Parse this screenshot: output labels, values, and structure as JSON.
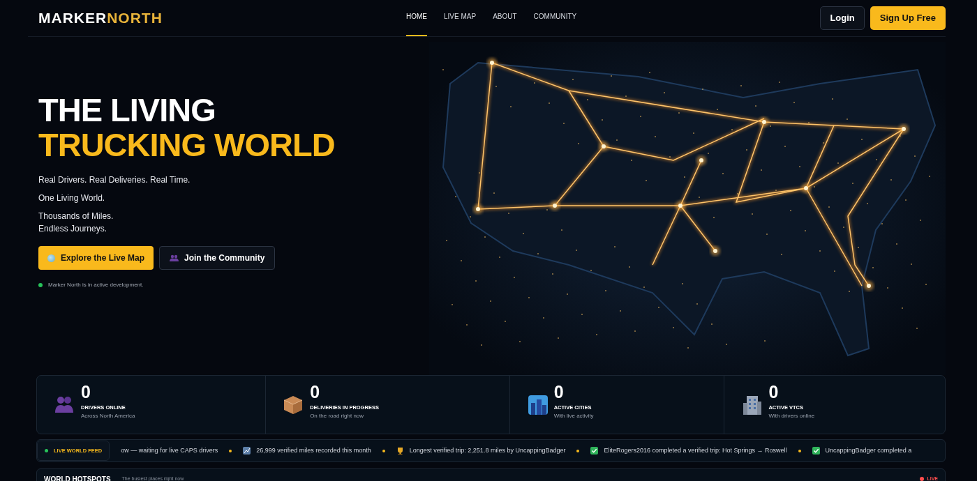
{
  "brand": {
    "first": "MARKER",
    "second": "NORTH"
  },
  "nav": [
    {
      "label": "HOME",
      "selected": true
    },
    {
      "label": "LIVE MAP",
      "selected": false
    },
    {
      "label": "ABOUT",
      "selected": false
    },
    {
      "label": "COMMUNITY",
      "selected": false
    }
  ],
  "auth": {
    "login": "Login",
    "signup": "Sign Up Free"
  },
  "hero": {
    "title": "THE LIVING",
    "title_highlight": "TRUCKING WORLD",
    "lines": [
      [
        "Real Drivers. Real Deliveries. Real Time."
      ],
      [
        "One Living World."
      ],
      [
        "Thousands of Miles.",
        "Endless Journeys."
      ]
    ],
    "buttons": [
      {
        "kind": "primary",
        "label": "Explore the Live Map"
      },
      {
        "kind": "outline",
        "label": "Join the Community"
      }
    ],
    "status": "Marker North is in active development."
  },
  "stats": [
    {
      "kind": "drivers",
      "value": "0",
      "label": "DRIVERS ONLINE",
      "sub": "Across North America"
    },
    {
      "kind": "deliveries",
      "value": "0",
      "label": "DELIVERIES IN PROGRESS",
      "sub": "On the road right now"
    },
    {
      "kind": "cities",
      "value": "0",
      "label": "ACTIVE CITIES",
      "sub": "With live activity"
    },
    {
      "kind": "vtcs",
      "value": "0",
      "label": "ACTIVE VTCS",
      "sub": "With drivers online"
    }
  ],
  "feed": {
    "label": "LIVE WORLD FEED",
    "items": [
      {
        "kind": "text",
        "text": "ow — waiting for live CAPS drivers"
      },
      {
        "kind": "chart",
        "text": "26,999 verified miles recorded this month"
      },
      {
        "kind": "trophy",
        "text": "Longest verified trip: 2,251.8 miles by UncappingBadger"
      },
      {
        "kind": "check",
        "text": "EliteRogers2016 completed a verified trip: Hot Springs → Roswell"
      },
      {
        "kind": "check",
        "text": "UncappingBadger completed a"
      }
    ]
  },
  "hotspots": {
    "title": "WORLD HOTSPOTS",
    "subtitle": "The busiest places right now",
    "badge": "LIVE"
  }
}
